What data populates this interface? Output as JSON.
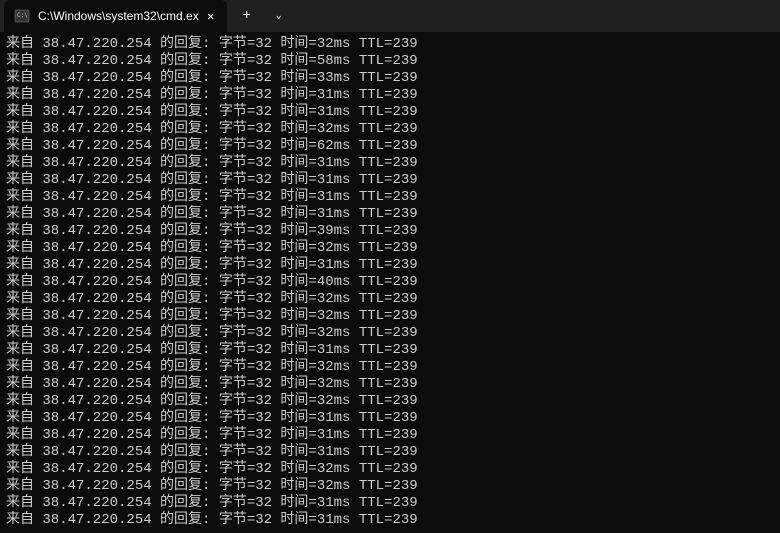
{
  "titlebar": {
    "tab_title": "C:\\Windows\\system32\\cmd.ex",
    "new_tab_symbol": "+",
    "dropdown_symbol": "⌄",
    "close_symbol": "✕"
  },
  "ping": {
    "ip": "38.47.220.254",
    "prefix": "来自",
    "reply_text": "的回复:",
    "bytes_label": "字节",
    "bytes_value": "32",
    "time_label": "时间",
    "ttl_label": "TTL",
    "ttl_value": "239",
    "times": [
      "32",
      "58",
      "33",
      "31",
      "31",
      "32",
      "62",
      "31",
      "31",
      "31",
      "31",
      "39",
      "32",
      "31",
      "40",
      "32",
      "32",
      "32",
      "31",
      "32",
      "32",
      "32",
      "31",
      "31",
      "31",
      "32",
      "32",
      "31",
      "31"
    ]
  }
}
